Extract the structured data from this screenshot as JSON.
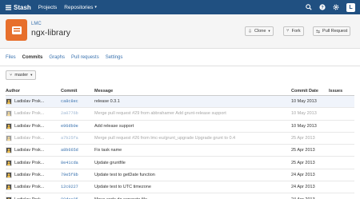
{
  "nav": {
    "brand": "Stash",
    "links": [
      "Projects",
      "Repositories"
    ],
    "avatar_letter": "L"
  },
  "repo": {
    "project": "LMC",
    "name": "ngx-library",
    "buttons": {
      "clone": "Clone",
      "fork": "Fork",
      "pull_request": "Pull Request"
    }
  },
  "tabs": [
    "Files",
    "Commits",
    "Graphs",
    "Pull requests",
    "Settings"
  ],
  "branch": "master",
  "table": {
    "headers": {
      "author": "Author",
      "commit": "Commit",
      "message": "Message",
      "date": "Commit Date",
      "issues": "Issues"
    },
    "rows": [
      {
        "author": "Ladislav Prsk...",
        "commit": "ca8c8ec",
        "message": "release 0.3.1",
        "date": "10 May 2013",
        "merge": false,
        "highlight": true
      },
      {
        "author": "Ladislav Prsk...",
        "commit": "2a0776b",
        "message": "Merge pull request #29 from abbrahamer Add grunt-release support",
        "date": "10 May 2013",
        "merge": true,
        "highlight": false
      },
      {
        "author": "Ladislav Prsk...",
        "commit": "e96db0e",
        "message": "Add release support",
        "date": "10 May 2013",
        "merge": false,
        "highlight": false
      },
      {
        "author": "Ladislav Prsk...",
        "commit": "a7b25fa",
        "message": "Merge pull request #26 from lmc-eu/grunt_upgrade Upgrade grunt to 0.4",
        "date": "25 Apr 2013",
        "merge": true,
        "highlight": false
      },
      {
        "author": "Ladislav Prsk...",
        "commit": "a8b665d",
        "message": "Fix task name",
        "date": "25 Apr 2013",
        "merge": false,
        "highlight": false
      },
      {
        "author": "Ladislav Prsk...",
        "commit": "8e41cda",
        "message": "Update gruntfile",
        "date": "25 Apr 2013",
        "merge": false,
        "highlight": false
      },
      {
        "author": "Ladislav Prsk...",
        "commit": "79e5f8b",
        "message": "Update test to getDate function",
        "date": "24 Apr 2013",
        "merge": false,
        "highlight": false
      },
      {
        "author": "Ladislav Prsk...",
        "commit": "12c0227",
        "message": "Update test to UTC timezone",
        "date": "24 Apr 2013",
        "merge": false,
        "highlight": false
      },
      {
        "author": "Ladislav Prsk...",
        "commit": "80dec05",
        "message": "Move code do separate file",
        "date": "24 Apr 2013",
        "merge": false,
        "highlight": false
      }
    ]
  },
  "colors": {
    "nav_bg": "#205081",
    "link": "#3b73af",
    "repo_avatar": "#e76f2c"
  }
}
